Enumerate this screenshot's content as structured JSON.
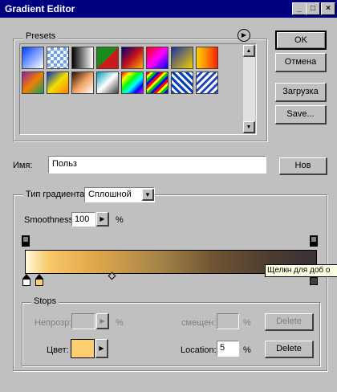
{
  "window": {
    "title": "Gradient Editor"
  },
  "titlebar_buttons": [
    "_",
    "□",
    "×"
  ],
  "presets": {
    "label": "Presets",
    "swatches": [
      "linear-gradient(135deg,#0040ff,#ffffff)",
      "repeating-conic-gradient(#6fa0ff 0 25%,#ffffff 0 50%) 0 0/8px 8px",
      "linear-gradient(90deg,#000000,#ffffff)",
      "linear-gradient(135deg,#1a8c1a 50%,#cc1a1a 50%)",
      "linear-gradient(135deg,#00007a,#c01020,#ffb000)",
      "linear-gradient(135deg,#ff0000,#ff00ff,#0000ff)",
      "linear-gradient(135deg,#2030a0,#f0d000)",
      "linear-gradient(90deg,#ffd000,#ff8000,#ff2000)",
      "linear-gradient(135deg,#9020a0,#f08000,#10a060)",
      "linear-gradient(135deg,#0030c0,#f0e000,#ff8000)",
      "linear-gradient(135deg,#301000,#f0a060,#ffffff)",
      "linear-gradient(135deg,#00a0c0,#ffffff,#404040)",
      "linear-gradient(135deg,#ff0000,#ffff00,#00ff00,#00ffff,#0000ff,#ff00ff)",
      "repeating-linear-gradient(135deg,#ff0000 0 3px,#ffff00 3px 6px,#00c000 6px 9px,#0000ff 9px 12px)",
      "repeating-linear-gradient(45deg,#0040c0 0 3px,#ffffff 3px 6px)",
      "repeating-linear-gradient(135deg,#ffffff 0 3px,#2040c0 3px 6px)"
    ]
  },
  "buttons": {
    "ok": "OK",
    "cancel": "Отмена",
    "load": "Загрузка",
    "save": "Save...",
    "new": "Нов"
  },
  "name_field": {
    "label": "Имя:",
    "value": "Польз"
  },
  "gradient_type": {
    "label": "Тип градиента:",
    "value": "Сплошной"
  },
  "smoothness": {
    "label": "Smoothness:",
    "value": "100",
    "unit": "%"
  },
  "gradient": {
    "css": "linear-gradient(90deg,#fff8dc 0%,#f7c868 8%,#e4aa4c 22%,#a88648 45%,#6e5434 65%,#4a3c30 85%,#3a3038 100%)"
  },
  "tooltip": "Щелкн для доб о",
  "stops": {
    "label": "Stops",
    "opacity_label": "Непрозр:",
    "opacity_unit": "%",
    "location_label_top": "смещен:",
    "location_unit_top": "%",
    "delete_top": "Delete",
    "color_label": "Цвет:",
    "color_value": "#fdcf6e",
    "location_label": "Location:",
    "location_value": "5",
    "location_unit": "%",
    "delete": "Delete"
  }
}
